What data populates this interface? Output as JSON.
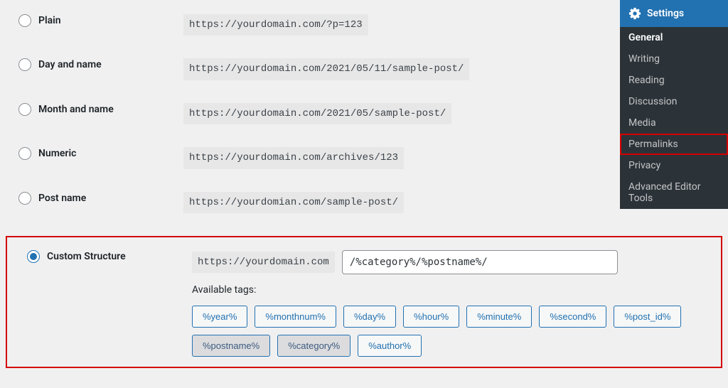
{
  "options": [
    {
      "key": "plain",
      "label": "Plain",
      "example": "https://yourdomain.com/?p=123",
      "checked": false
    },
    {
      "key": "day_name",
      "label": "Day and name",
      "example": "https://yourdomain.com/2021/05/11/sample-post/",
      "checked": false
    },
    {
      "key": "month_name",
      "label": "Month and name",
      "example": "https://yourdomain.com/2021/05/sample-post/",
      "checked": false
    },
    {
      "key": "numeric",
      "label": "Numeric",
      "example": "https://yourdomain.com/archives/123",
      "checked": false
    },
    {
      "key": "post_name",
      "label": "Post name",
      "example": "https://yourdomian.com/sample-post/",
      "checked": false
    }
  ],
  "custom": {
    "label": "Custom Structure",
    "prefix": "https://yourdomain.com",
    "value": "/%category%/%postname%/",
    "available_label": "Available tags:",
    "checked": true,
    "tags": [
      {
        "text": "%year%",
        "active": false
      },
      {
        "text": "%monthnum%",
        "active": false
      },
      {
        "text": "%day%",
        "active": false
      },
      {
        "text": "%hour%",
        "active": false
      },
      {
        "text": "%minute%",
        "active": false
      },
      {
        "text": "%second%",
        "active": false
      },
      {
        "text": "%post_id%",
        "active": false
      },
      {
        "text": "%postname%",
        "active": true
      },
      {
        "text": "%category%",
        "active": true
      },
      {
        "text": "%author%",
        "active": false
      }
    ]
  },
  "sidebar": {
    "title": "Settings",
    "items": [
      {
        "label": "General",
        "current": true,
        "highlight": false
      },
      {
        "label": "Writing",
        "current": false,
        "highlight": false
      },
      {
        "label": "Reading",
        "current": false,
        "highlight": false
      },
      {
        "label": "Discussion",
        "current": false,
        "highlight": false
      },
      {
        "label": "Media",
        "current": false,
        "highlight": false
      },
      {
        "label": "Permalinks",
        "current": false,
        "highlight": true
      },
      {
        "label": "Privacy",
        "current": false,
        "highlight": false
      },
      {
        "label": "Advanced Editor Tools",
        "current": false,
        "highlight": false
      }
    ]
  }
}
